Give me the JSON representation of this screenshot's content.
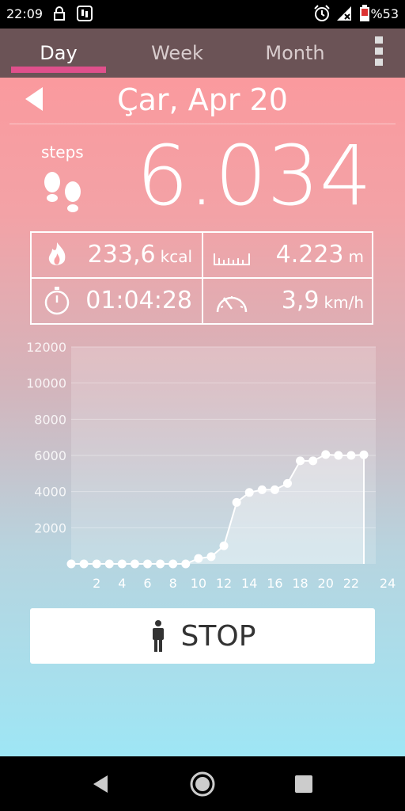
{
  "status_bar": {
    "time": "22:09",
    "battery_text": "%53",
    "icons": [
      "lock-icon",
      "app-notification-icon",
      "alarm-icon",
      "signal-icon",
      "battery-icon"
    ]
  },
  "tabs": [
    {
      "label": "Day",
      "active": true
    },
    {
      "label": "Week",
      "active": false
    },
    {
      "label": "Month",
      "active": false
    }
  ],
  "date_label": "Çar, Apr 20",
  "steps": {
    "label": "steps",
    "value": "6.034"
  },
  "stats": {
    "calories": {
      "value": "233,6",
      "unit": "kcal"
    },
    "distance": {
      "value": "4.223",
      "unit": "m"
    },
    "duration": {
      "value": "01:04:28",
      "unit": ""
    },
    "speed": {
      "value": "3,9",
      "unit": "km/h"
    }
  },
  "chart_data": {
    "type": "line",
    "x": [
      0,
      1,
      2,
      3,
      4,
      5,
      6,
      7,
      8,
      9,
      10,
      11,
      12,
      13,
      14,
      15,
      16,
      17,
      18,
      19,
      20,
      21,
      22,
      23
    ],
    "values": [
      0,
      0,
      0,
      0,
      0,
      0,
      0,
      0,
      0,
      0,
      300,
      400,
      1000,
      3400,
      3950,
      4100,
      4100,
      4450,
      5700,
      5700,
      6050,
      6000,
      6000,
      6034
    ],
    "x_ticks": [
      "2",
      "4",
      "6",
      "8",
      "10",
      "12",
      "14",
      "16",
      "18",
      "20",
      "22",
      "24"
    ],
    "y_ticks": [
      "2000",
      "4000",
      "6000",
      "8000",
      "10000",
      "12000"
    ],
    "xlim": [
      0,
      24
    ],
    "ylim": [
      0,
      12000
    ],
    "grid": true
  },
  "stop_button": {
    "label": "STOP"
  },
  "colors": {
    "tab_bar": "#6b5356",
    "tab_indicator": "#e0508c",
    "gradient_top": "#fa9a9e",
    "gradient_bottom": "#9ee6f5"
  }
}
